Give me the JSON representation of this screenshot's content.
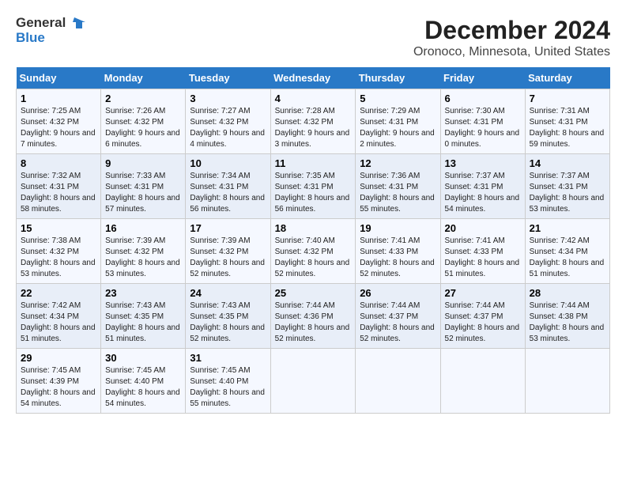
{
  "logo": {
    "line1": "General",
    "line2": "Blue"
  },
  "title": "December 2024",
  "subtitle": "Oronoco, Minnesota, United States",
  "weekdays": [
    "Sunday",
    "Monday",
    "Tuesday",
    "Wednesday",
    "Thursday",
    "Friday",
    "Saturday"
  ],
  "weeks": [
    [
      {
        "day": "1",
        "sunrise": "7:25 AM",
        "sunset": "4:32 PM",
        "daylight": "9 hours and 7 minutes."
      },
      {
        "day": "2",
        "sunrise": "7:26 AM",
        "sunset": "4:32 PM",
        "daylight": "9 hours and 6 minutes."
      },
      {
        "day": "3",
        "sunrise": "7:27 AM",
        "sunset": "4:32 PM",
        "daylight": "9 hours and 4 minutes."
      },
      {
        "day": "4",
        "sunrise": "7:28 AM",
        "sunset": "4:32 PM",
        "daylight": "9 hours and 3 minutes."
      },
      {
        "day": "5",
        "sunrise": "7:29 AM",
        "sunset": "4:31 PM",
        "daylight": "9 hours and 2 minutes."
      },
      {
        "day": "6",
        "sunrise": "7:30 AM",
        "sunset": "4:31 PM",
        "daylight": "9 hours and 0 minutes."
      },
      {
        "day": "7",
        "sunrise": "7:31 AM",
        "sunset": "4:31 PM",
        "daylight": "8 hours and 59 minutes."
      }
    ],
    [
      {
        "day": "8",
        "sunrise": "7:32 AM",
        "sunset": "4:31 PM",
        "daylight": "8 hours and 58 minutes."
      },
      {
        "day": "9",
        "sunrise": "7:33 AM",
        "sunset": "4:31 PM",
        "daylight": "8 hours and 57 minutes."
      },
      {
        "day": "10",
        "sunrise": "7:34 AM",
        "sunset": "4:31 PM",
        "daylight": "8 hours and 56 minutes."
      },
      {
        "day": "11",
        "sunrise": "7:35 AM",
        "sunset": "4:31 PM",
        "daylight": "8 hours and 56 minutes."
      },
      {
        "day": "12",
        "sunrise": "7:36 AM",
        "sunset": "4:31 PM",
        "daylight": "8 hours and 55 minutes."
      },
      {
        "day": "13",
        "sunrise": "7:37 AM",
        "sunset": "4:31 PM",
        "daylight": "8 hours and 54 minutes."
      },
      {
        "day": "14",
        "sunrise": "7:37 AM",
        "sunset": "4:31 PM",
        "daylight": "8 hours and 53 minutes."
      }
    ],
    [
      {
        "day": "15",
        "sunrise": "7:38 AM",
        "sunset": "4:32 PM",
        "daylight": "8 hours and 53 minutes."
      },
      {
        "day": "16",
        "sunrise": "7:39 AM",
        "sunset": "4:32 PM",
        "daylight": "8 hours and 53 minutes."
      },
      {
        "day": "17",
        "sunrise": "7:39 AM",
        "sunset": "4:32 PM",
        "daylight": "8 hours and 52 minutes."
      },
      {
        "day": "18",
        "sunrise": "7:40 AM",
        "sunset": "4:32 PM",
        "daylight": "8 hours and 52 minutes."
      },
      {
        "day": "19",
        "sunrise": "7:41 AM",
        "sunset": "4:33 PM",
        "daylight": "8 hours and 52 minutes."
      },
      {
        "day": "20",
        "sunrise": "7:41 AM",
        "sunset": "4:33 PM",
        "daylight": "8 hours and 51 minutes."
      },
      {
        "day": "21",
        "sunrise": "7:42 AM",
        "sunset": "4:34 PM",
        "daylight": "8 hours and 51 minutes."
      }
    ],
    [
      {
        "day": "22",
        "sunrise": "7:42 AM",
        "sunset": "4:34 PM",
        "daylight": "8 hours and 51 minutes."
      },
      {
        "day": "23",
        "sunrise": "7:43 AM",
        "sunset": "4:35 PM",
        "daylight": "8 hours and 51 minutes."
      },
      {
        "day": "24",
        "sunrise": "7:43 AM",
        "sunset": "4:35 PM",
        "daylight": "8 hours and 52 minutes."
      },
      {
        "day": "25",
        "sunrise": "7:44 AM",
        "sunset": "4:36 PM",
        "daylight": "8 hours and 52 minutes."
      },
      {
        "day": "26",
        "sunrise": "7:44 AM",
        "sunset": "4:37 PM",
        "daylight": "8 hours and 52 minutes."
      },
      {
        "day": "27",
        "sunrise": "7:44 AM",
        "sunset": "4:37 PM",
        "daylight": "8 hours and 52 minutes."
      },
      {
        "day": "28",
        "sunrise": "7:44 AM",
        "sunset": "4:38 PM",
        "daylight": "8 hours and 53 minutes."
      }
    ],
    [
      {
        "day": "29",
        "sunrise": "7:45 AM",
        "sunset": "4:39 PM",
        "daylight": "8 hours and 54 minutes."
      },
      {
        "day": "30",
        "sunrise": "7:45 AM",
        "sunset": "4:40 PM",
        "daylight": "8 hours and 54 minutes."
      },
      {
        "day": "31",
        "sunrise": "7:45 AM",
        "sunset": "4:40 PM",
        "daylight": "8 hours and 55 minutes."
      },
      null,
      null,
      null,
      null
    ]
  ],
  "labels": {
    "sunrise": "Sunrise:",
    "sunset": "Sunset:",
    "daylight": "Daylight:"
  }
}
